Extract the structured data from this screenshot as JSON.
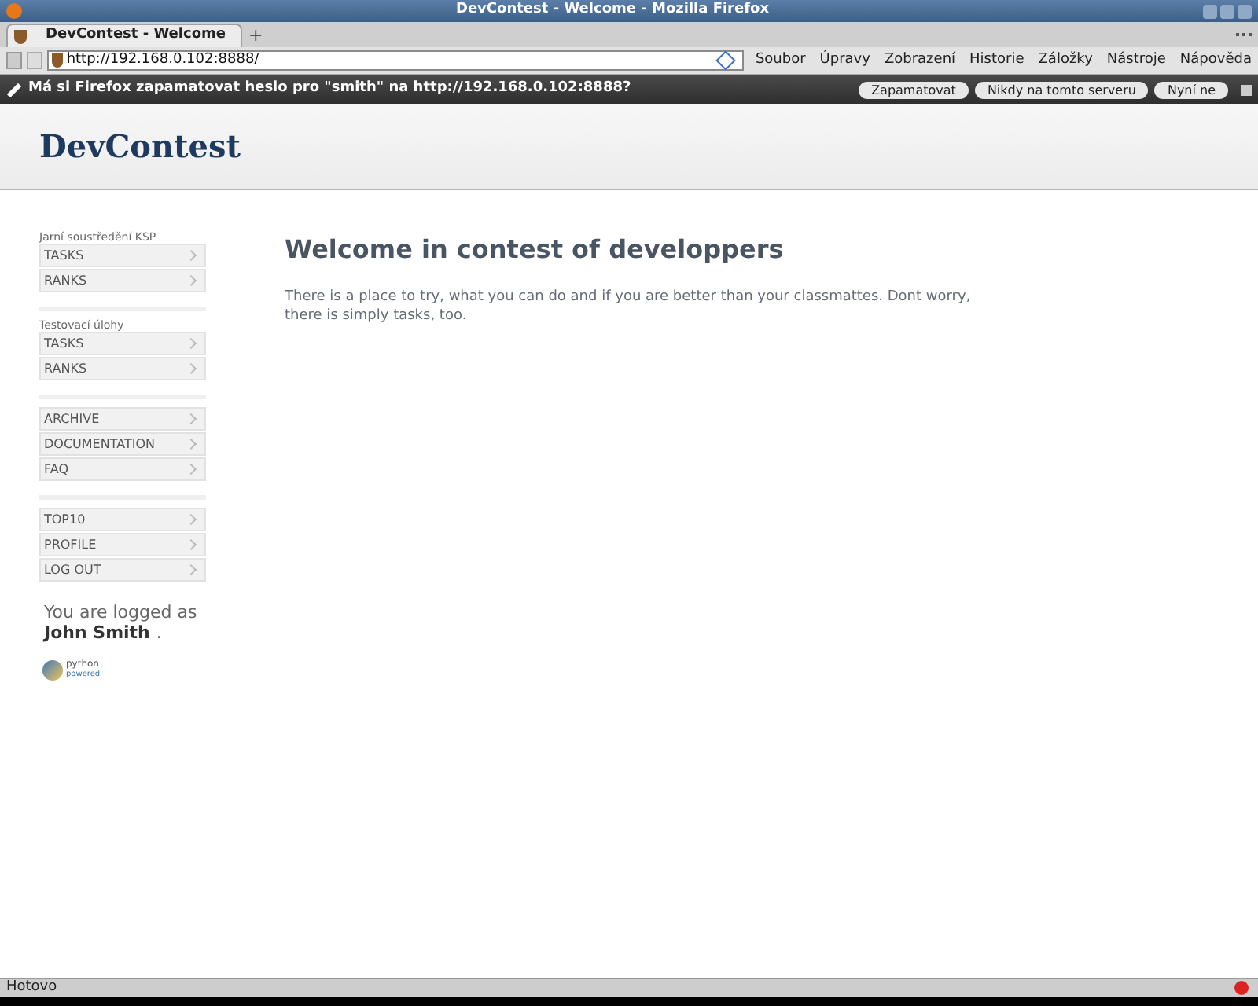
{
  "window": {
    "title": "DevContest - Welcome - Mozilla Firefox"
  },
  "tabs": [
    {
      "label": "DevContest - Welcome",
      "selected": true
    }
  ],
  "new_tab": "+",
  "address_bar": {
    "url": "http://192.168.0.102:8888/"
  },
  "menu": [
    "Soubor",
    "Úpravy",
    "Zobrazení",
    "Historie",
    "Záložky",
    "Nástroje",
    "Nápověda"
  ],
  "password_bar": {
    "message": "Má si Firefox zapamatovat heslo pro \"smith\" na http://192.168.0.102:8888?",
    "buttons": [
      "Zapamatovat",
      "Nikdy na tomto serveru",
      "Nyní ne"
    ]
  },
  "page": {
    "logo": "DevContest",
    "sidebar": [
      {
        "label": "Jarní soustředění KSP",
        "items": [
          "TASKS",
          "RANKS"
        ]
      },
      {
        "label": "Testovací úlohy",
        "items": [
          "TASKS",
          "RANKS"
        ]
      },
      {
        "items": [
          "ARCHIVE",
          "DOCUMENTATION",
          "FAQ"
        ]
      },
      {
        "items": [
          "TOP10",
          "PROFILE",
          "LOG OUT"
        ]
      }
    ],
    "logged_as": "You are logged as",
    "user": "John Smith",
    "user_suffix": ".",
    "badge": [
      "python",
      "powered"
    ],
    "heading": "Welcome in contest of developpers",
    "text": "There is a place to try, what you can do and if you are better than your classmattes. Dont worry, there is simply tasks, too."
  },
  "status_bar": "Hotovo"
}
